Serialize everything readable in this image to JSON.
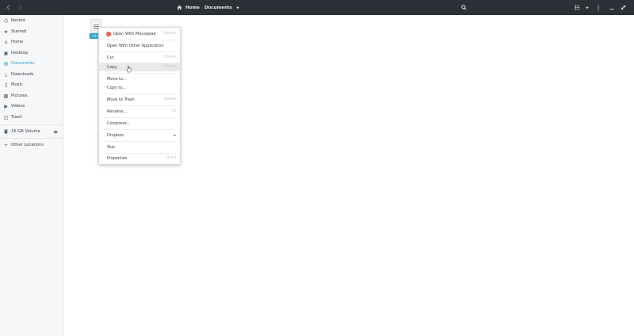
{
  "header": {
    "back_icon": "arrow-left-icon",
    "forward_icon": "arrow-right-icon",
    "breadcrumb": {
      "home_label": "Home",
      "current_label": "Documents"
    }
  },
  "sidebar": {
    "items": [
      {
        "label": "Recent",
        "icon": "clock-icon"
      },
      {
        "label": "Starred",
        "icon": "star-icon"
      },
      {
        "label": "Home",
        "icon": "home-icon"
      },
      {
        "label": "Desktop",
        "icon": "desktop-icon"
      },
      {
        "label": "Documents",
        "icon": "document-icon",
        "active": true
      },
      {
        "label": "Downloads",
        "icon": "download-icon"
      },
      {
        "label": "Music",
        "icon": "music-icon"
      },
      {
        "label": "Pictures",
        "icon": "picture-icon"
      },
      {
        "label": "Videos",
        "icon": "video-icon"
      },
      {
        "label": "Trash",
        "icon": "trash-icon"
      }
    ],
    "volume_label": "16 GB Volume",
    "other_locations_label": "Other Locations"
  },
  "file": {
    "label": "info"
  },
  "context_menu": {
    "items": [
      {
        "label": "Open With Mousepad",
        "accel": "Return"
      },
      {
        "label": "Open With Other Application",
        "accel": ""
      },
      {
        "label": "Cut",
        "accel": "Ctrl+X"
      },
      {
        "label": "Copy",
        "accel": "Ctrl+C"
      },
      {
        "label": "Move to...",
        "accel": ""
      },
      {
        "label": "Copy to...",
        "accel": ""
      },
      {
        "label": "Move to Trash",
        "accel": "Delete"
      },
      {
        "label": "Rename...",
        "accel": "F2"
      },
      {
        "label": "Compress...",
        "accel": ""
      },
      {
        "label": "Dropbox",
        "accel": ""
      },
      {
        "label": "Star",
        "accel": ""
      },
      {
        "label": "Properties",
        "accel": "Ctrl+I"
      }
    ]
  },
  "colors": {
    "header_bg": "#2b3136",
    "accent": "#2aa2d0",
    "sidebar_bg": "#f6f7f8"
  }
}
